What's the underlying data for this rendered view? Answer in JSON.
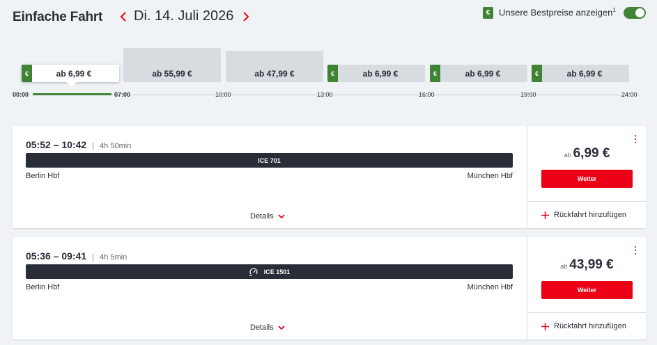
{
  "header": {
    "title": "Einfache Fahrt",
    "date": "Di. 14. Juli 2026",
    "best_price_label": "Unsere Bestpreise anzeigen",
    "best_price_footnote": "1",
    "euro_symbol": "€",
    "toggle_on": true
  },
  "timeline": {
    "slots": [
      {
        "label": "ab 6,99 €",
        "best": true
      },
      {
        "label": "ab 55,99 €",
        "best": false
      },
      {
        "label": "ab 47,99 €",
        "best": false
      },
      {
        "label": "ab 6,99 €",
        "best": true
      },
      {
        "label": "ab 6,99 €",
        "best": true
      },
      {
        "label": "ab 6,99 €",
        "best": true
      }
    ],
    "ticks": [
      "00:00",
      "07:00",
      "10:00",
      "13:00",
      "16:00",
      "19:00",
      "24:00"
    ]
  },
  "connections": [
    {
      "departure": "05:52",
      "arrival": "10:42",
      "duration": "4h 50min",
      "train": "ICE 701",
      "from": "Berlin Hbf",
      "to": "München Hbf",
      "details_label": "Details",
      "price_prefix": "ab",
      "price": "6,99 €",
      "cta": "Weiter",
      "return_label": "Rückfahrt hinzufügen"
    },
    {
      "departure": "05:36",
      "arrival": "09:41",
      "duration": "4h 5min",
      "train": "ICE 1501",
      "from": "Berlin Hbf",
      "to": "München Hbf",
      "details_label": "Details",
      "price_prefix": "ab",
      "price": "43,99 €",
      "cta": "Weiter",
      "return_label": "Rückfahrt hinzufügen"
    }
  ],
  "colors": {
    "accent_red": "#ec0016",
    "best_green": "#408335",
    "train_bar": "#282d37"
  }
}
